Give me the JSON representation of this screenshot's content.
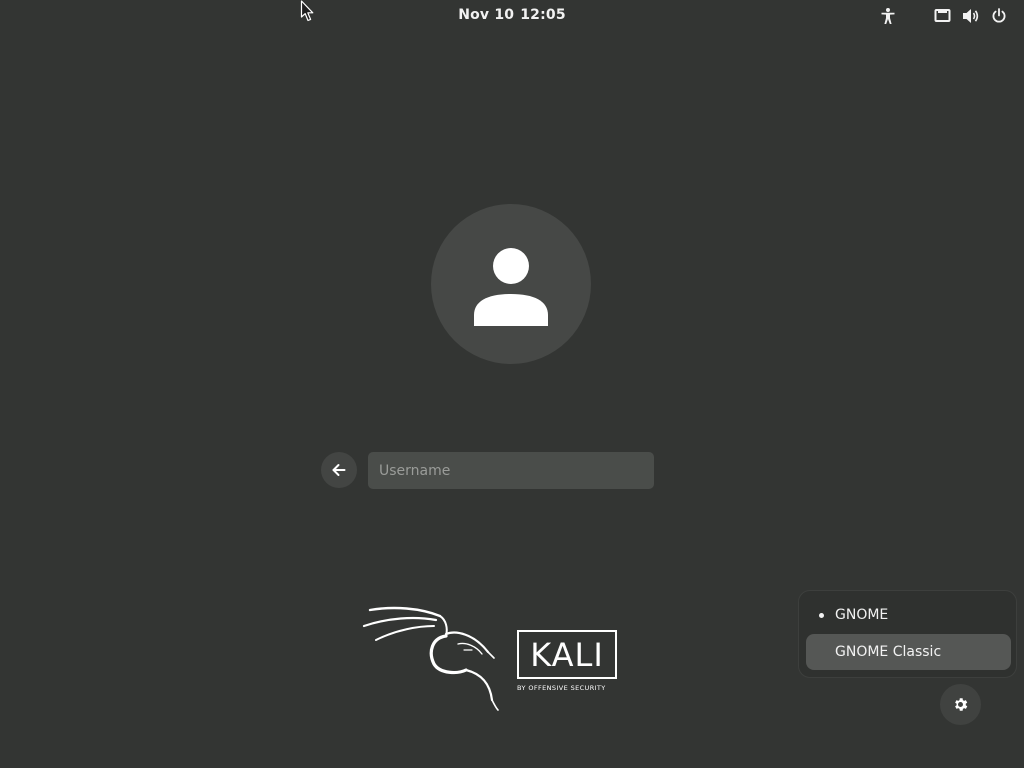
{
  "top_bar": {
    "date": "Nov 10",
    "time": "12:05",
    "icons": [
      "accessibility-icon",
      "network-wired-icon",
      "volume-icon",
      "power-icon"
    ]
  },
  "login": {
    "avatar_icon": "user-avatar-icon",
    "back_icon": "arrow-left-icon",
    "username_placeholder": "Username",
    "username_value": ""
  },
  "branding": {
    "logo_word": "KALI",
    "logo_tagline": "BY OFFENSIVE SECURITY"
  },
  "session_menu": {
    "items": [
      {
        "label": "GNOME",
        "selected": true
      },
      {
        "label": "GNOME Classic",
        "selected": false,
        "hovered": true
      }
    ],
    "button_icon": "gear-icon"
  },
  "colors": {
    "background": "#333533",
    "avatar_bg": "#464846",
    "field_bg": "#4a4d4a",
    "menu_bg": "#2f312f",
    "menu_hover": "#555755",
    "text": "#f2f2f2",
    "placeholder": "#9a9c99"
  }
}
